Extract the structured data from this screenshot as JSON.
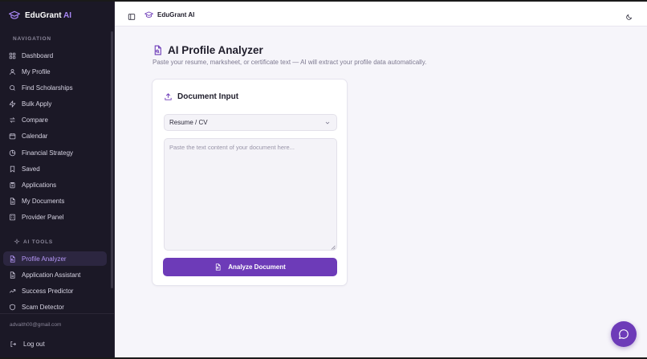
{
  "app": {
    "brand_main": "EduGrant",
    "brand_accent": "AI",
    "topbar_title": "EduGrant AI",
    "accent_color": "#6d3bb8"
  },
  "sidebar": {
    "nav_section_label": "NAVIGATION",
    "items": [
      {
        "label": "Dashboard",
        "icon": "grid-icon"
      },
      {
        "label": "My Profile",
        "icon": "user-icon"
      },
      {
        "label": "Find Scholarships",
        "icon": "search-icon"
      },
      {
        "label": "Bulk Apply",
        "icon": "zap-icon"
      },
      {
        "label": "Compare",
        "icon": "compare-arrows-icon"
      },
      {
        "label": "Calendar",
        "icon": "calendar-icon"
      },
      {
        "label": "Financial Strategy",
        "icon": "pie-chart-icon"
      },
      {
        "label": "Saved",
        "icon": "bookmark-icon"
      },
      {
        "label": "Applications",
        "icon": "clipboard-icon"
      },
      {
        "label": "My Documents",
        "icon": "file-text-icon"
      },
      {
        "label": "Provider Panel",
        "icon": "building-icon"
      }
    ],
    "ai_section_label": "AI TOOLS",
    "ai_items": [
      {
        "label": "Profile Analyzer",
        "icon": "file-scan-icon",
        "active": true
      },
      {
        "label": "Application Assistant",
        "icon": "file-text-icon"
      },
      {
        "label": "Success Predictor",
        "icon": "trending-up-icon"
      },
      {
        "label": "Scam Detector",
        "icon": "shield-icon"
      }
    ],
    "user_email": "advaith00@gmail.com",
    "logout_label": "Log out"
  },
  "main": {
    "title": "AI Profile Analyzer",
    "subtitle": "Paste your resume, marksheet, or certificate text — AI will extract your profile data automatically.",
    "card": {
      "title": "Document Input",
      "select_value": "Resume / CV",
      "textarea_placeholder": "Paste the text content of your document here...",
      "button_label": "Analyze Document"
    }
  }
}
